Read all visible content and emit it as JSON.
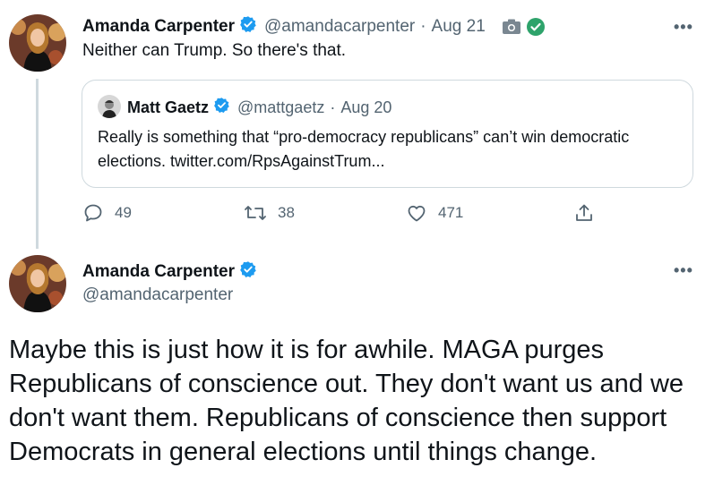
{
  "tweet1": {
    "name": "Amanda Carpenter",
    "handle": "@amandacarpenter",
    "separator": "·",
    "time": "Aug 21",
    "text": "Neither can Trump. So there's that.",
    "more": "•••",
    "quote": {
      "name": "Matt Gaetz",
      "handle": "@mattgaetz",
      "separator": "·",
      "time": "Aug 20",
      "text": "Really is something that “pro-democracy republicans” can’t win democratic elections. twitter.com/RpsAgainstTrum..."
    },
    "actions": {
      "replies": "49",
      "retweets": "38",
      "likes": "471"
    }
  },
  "tweet2": {
    "name": "Amanda Carpenter",
    "handle": "@amandacarpenter",
    "more": "•••",
    "text": "Maybe this is just how it is for awhile. MAGA purges Republicans of conscience out. They don't want us and we don't want them. Republicans of conscience then support Democrats in general elections until things change."
  },
  "colors": {
    "verified": "#1d9bf0",
    "secondary_text": "#536471",
    "border": "#cfd9de",
    "text": "#0f1419"
  }
}
